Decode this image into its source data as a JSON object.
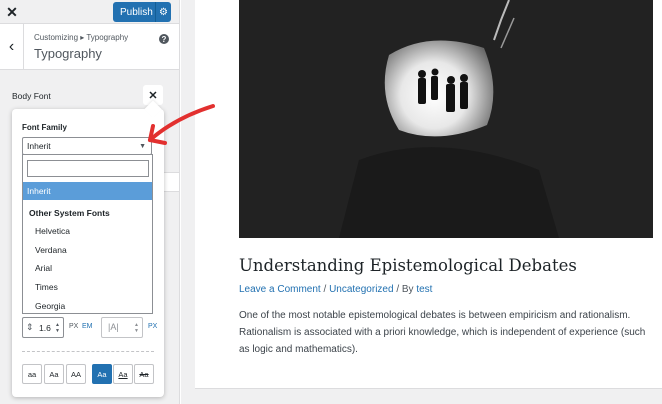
{
  "topbar": {
    "close_icon": "close-icon",
    "publish_label": "Publish",
    "publish_gear_icon": "gear-icon"
  },
  "section": {
    "breadcrumb": "Customizing ▸ Typography",
    "title": "Typography",
    "back_icon": "chevron-left-icon",
    "help_icon": "help-icon"
  },
  "body_font": {
    "label": "Body Font",
    "clear_icon": "close-icon"
  },
  "popup": {
    "font_family_label": "Font Family",
    "selected_value": "Inherit",
    "dropdown": {
      "search_value": "",
      "highlighted": "Inherit",
      "group_label": "Other System Fonts",
      "options": [
        "Helvetica",
        "Verdana",
        "Arial",
        "Times",
        "Georgia"
      ]
    },
    "line_height": {
      "value": "1.6",
      "unit_px": "PX",
      "unit_em": "EM",
      "active_unit": "EM"
    },
    "letter_spacing": {
      "value": "",
      "unit_px": "PX"
    },
    "text_transform_buttons": [
      "aa",
      "Aa",
      "AA"
    ],
    "text_decoration_buttons": [
      "Aa",
      "Aa",
      "Aa"
    ],
    "active_decoration_index": 0
  },
  "post": {
    "title": "Understanding Epistemological Debates",
    "meta_link1": "Leave a Comment",
    "meta_sep1": " / ",
    "meta_link2": "Uncategorized",
    "meta_sep2": " / By ",
    "meta_author": "test",
    "excerpt": "One of the most notable epistemological debates is between empiricism and rationalism. Rationalism is associated with a priori knowledge, which is independent of experience (such as logic and mathematics)."
  },
  "colors": {
    "accent": "#2271b1",
    "highlight": "#5b9dd9",
    "arrow": "#e2302f"
  }
}
